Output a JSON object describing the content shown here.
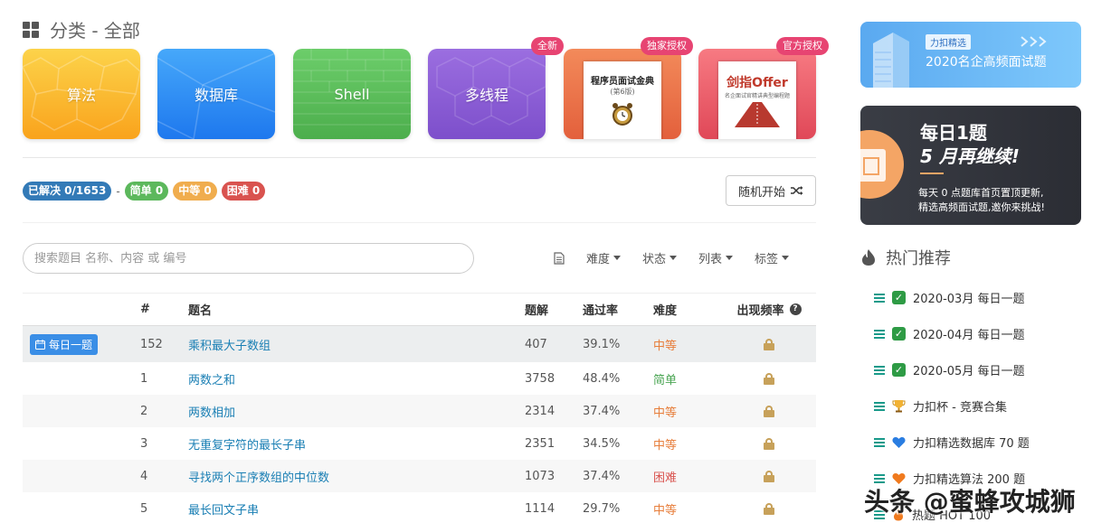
{
  "category": {
    "title": "分类 - 全部"
  },
  "cards": [
    {
      "label": "算法",
      "color": "#fbb32a"
    },
    {
      "label": "数据库",
      "color": "#2c8bf0"
    },
    {
      "label": "Shell",
      "color": "#5cc15c"
    },
    {
      "label": "多线程",
      "color": "#8a5cd6"
    },
    {
      "label": "",
      "book_title": "程序员面试金典",
      "book_sub": "(第6版)",
      "ribbon": "独家授权"
    },
    {
      "label": "",
      "book_title": "剑指Offer",
      "book_sub": "名企面试官精讲典型编程题",
      "ribbon": "官方授权"
    }
  ],
  "new_ribbon": "全新",
  "stats": {
    "solved": "已解决 0/1653",
    "dash": "-",
    "easy": "简单 0",
    "medium": "中等 0",
    "hard": "困难 0"
  },
  "random_button": "随机开始",
  "search": {
    "placeholder": "搜索题目 名称、内容 或 编号"
  },
  "filters": [
    "难度",
    "状态",
    "列表",
    "标签"
  ],
  "table": {
    "headers": [
      "#",
      "题名",
      "题解",
      "通过率",
      "难度",
      "出现频率"
    ],
    "daily_label": "每日一题",
    "rows": [
      {
        "id": "152",
        "title": "乘积最大子数组",
        "solutions": "407",
        "rate": "39.1%",
        "difficulty": "中等",
        "diff_color": "#e77e3b"
      },
      {
        "id": "1",
        "title": "两数之和",
        "solutions": "3758",
        "rate": "48.4%",
        "difficulty": "简单",
        "diff_color": "#4aa553"
      },
      {
        "id": "2",
        "title": "两数相加",
        "solutions": "2314",
        "rate": "37.4%",
        "difficulty": "中等",
        "diff_color": "#e77e3b"
      },
      {
        "id": "3",
        "title": "无重复字符的最长子串",
        "solutions": "2351",
        "rate": "34.5%",
        "difficulty": "中等",
        "diff_color": "#e77e3b"
      },
      {
        "id": "4",
        "title": "寻找两个正序数组的中位数",
        "solutions": "1073",
        "rate": "37.4%",
        "difficulty": "困难",
        "diff_color": "#d9534f"
      },
      {
        "id": "5",
        "title": "最长回文子串",
        "solutions": "1114",
        "rate": "29.7%",
        "difficulty": "中等",
        "diff_color": "#e77e3b"
      }
    ]
  },
  "sidebar": {
    "banner1": {
      "tag": "力扣精选",
      "title": "2020名企高频面试题"
    },
    "banner2": {
      "line1": "每日1题",
      "line2": "5 月再继续!",
      "desc1": "每天 0 点题库首页置顶更新,",
      "desc2": "精选高频面试题,邀你来挑战!"
    },
    "hot_title": "热门推荐",
    "hot_items": [
      {
        "icon": "check-icon",
        "text": "2020-03月 每日一题"
      },
      {
        "icon": "check-icon",
        "text": "2020-04月 每日一题"
      },
      {
        "icon": "check-icon",
        "text": "2020-05月 每日一题"
      },
      {
        "icon": "trophy-icon",
        "text": "力扣杯 - 竞赛合集"
      },
      {
        "icon": "blue-heart-icon",
        "text": "力扣精选数据库 70 题"
      },
      {
        "icon": "orange-heart-icon",
        "text": "力扣精选算法 200 题"
      },
      {
        "icon": "fire-icon",
        "text": "热题 HOT 100"
      }
    ]
  },
  "watermark": "头条 @蜜蜂攻城狮"
}
